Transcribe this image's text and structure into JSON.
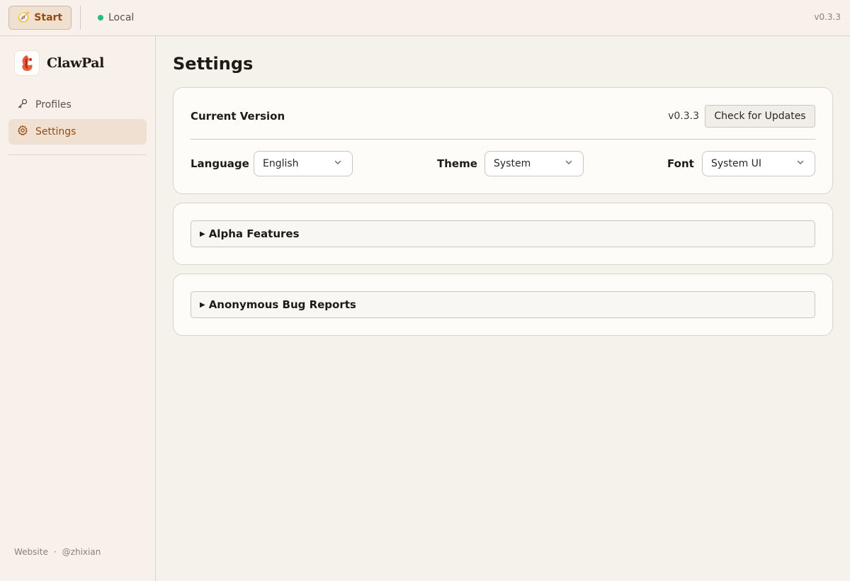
{
  "topbar": {
    "start_label": "Start",
    "start_icon": "compass-icon",
    "local_label": "Local",
    "local_status_color": "#22c07a",
    "version": "v0.3.3"
  },
  "sidebar": {
    "brand_name": "ClawPal",
    "items": [
      {
        "label": "Profiles",
        "icon": "key-icon",
        "active": false
      },
      {
        "label": "Settings",
        "icon": "gear-icon",
        "active": true
      }
    ],
    "footer": {
      "website_label": "Website",
      "separator": "·",
      "handle": "@zhixian"
    }
  },
  "main": {
    "title": "Settings",
    "version_card": {
      "current_version_label": "Current Version",
      "current_version_value": "v0.3.3",
      "check_updates_label": "Check for Updates",
      "language_label": "Language",
      "language_value": "English",
      "theme_label": "Theme",
      "theme_value": "System",
      "font_label": "Font",
      "font_value": "System UI"
    },
    "sections": [
      {
        "label": "Alpha Features",
        "expanded": false
      },
      {
        "label": "Anonymous Bug Reports",
        "expanded": false
      }
    ]
  },
  "colors": {
    "accent": "#9a4a10",
    "background": "#f5f1eb",
    "sidebar_bg": "#f8f0ea",
    "card_bg": "#fefcf9"
  }
}
